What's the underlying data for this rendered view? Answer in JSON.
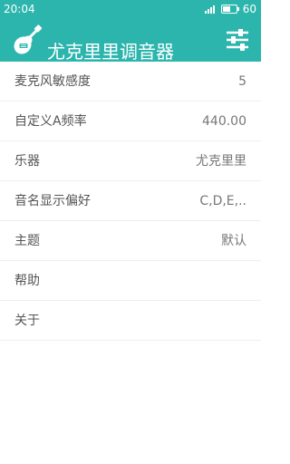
{
  "status_bar": {
    "time": "20:04",
    "battery_text": "60",
    "battery_level": 0.6,
    "signal_bars": 4
  },
  "app_bar": {
    "title": "尤克里里调音器",
    "logo_icon": "ukulele-icon",
    "settings_icon": "sliders-icon"
  },
  "settings": [
    {
      "label": "麦克风敏感度",
      "value": "5"
    },
    {
      "label": "自定义A频率",
      "value": "440.00"
    },
    {
      "label": "乐器",
      "value": "尤克里里"
    },
    {
      "label": "音名显示偏好",
      "value": "C,D,E,.."
    },
    {
      "label": "主题",
      "value": "默认"
    },
    {
      "label": "帮助",
      "value": ""
    },
    {
      "label": "关于",
      "value": ""
    }
  ],
  "colors": {
    "primary": "#2cb5ad",
    "text": "#555555",
    "value_text": "#777777",
    "divider": "#eeeeee"
  }
}
